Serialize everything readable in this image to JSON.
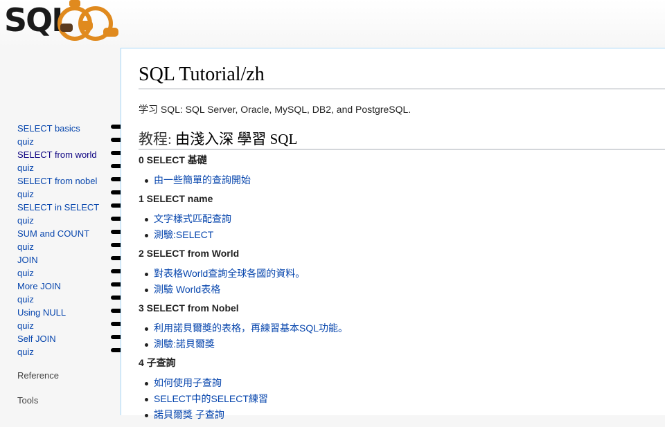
{
  "logo": {
    "text": "SQL",
    "alt": "sqlzoo-logo"
  },
  "sidebar": {
    "nav": [
      {
        "label": "SELECT basics",
        "visited": false
      },
      {
        "label": "quiz",
        "visited": false
      },
      {
        "label": "SELECT from world",
        "visited": true
      },
      {
        "label": "quiz",
        "visited": false
      },
      {
        "label": "SELECT from nobel",
        "visited": false
      },
      {
        "label": "quiz",
        "visited": false
      },
      {
        "label": "SELECT in SELECT",
        "visited": false
      },
      {
        "label": "quiz",
        "visited": false
      },
      {
        "label": "SUM and COUNT",
        "visited": false
      },
      {
        "label": "quiz",
        "visited": false
      },
      {
        "label": "JOIN",
        "visited": false
      },
      {
        "label": "quiz",
        "visited": false
      },
      {
        "label": "More JOIN",
        "visited": false
      },
      {
        "label": "quiz",
        "visited": false
      },
      {
        "label": "Using NULL",
        "visited": false
      },
      {
        "label": "quiz",
        "visited": false
      },
      {
        "label": "Self JOIN",
        "visited": false
      },
      {
        "label": "quiz",
        "visited": false
      }
    ],
    "reference_label": "Reference",
    "tools_label": "Tools"
  },
  "content": {
    "title": "SQL Tutorial/zh",
    "intro": "学习 SQL: SQL Server, Oracle, MySQL, DB2, and PostgreSQL.",
    "tutorial_heading_prefix": "教程:",
    "tutorial_heading_rest": " 由淺入深 學習 SQL",
    "lessons": [
      {
        "title": "0 SELECT 基礎",
        "links": [
          "由一些簡單的查詢開始"
        ]
      },
      {
        "title": "1 SELECT name",
        "links": [
          "文字樣式匹配查詢",
          "測驗:SELECT"
        ]
      },
      {
        "title": "2 SELECT from World",
        "links": [
          "對表格World查詢全球各國的資料。",
          "測驗 World表格"
        ]
      },
      {
        "title": "3 SELECT from Nobel",
        "links": [
          "利用諾貝爾獎的表格，再練習基本SQL功能。",
          "測驗:諾貝爾獎"
        ]
      },
      {
        "title": "4 子查詢",
        "links": [
          "如何使用子查詢",
          "SELECT中的SELECT練習",
          "諾貝爾獎 子查詢"
        ]
      }
    ]
  },
  "colors": {
    "link": "#0645ad",
    "visited": "#0b0080",
    "content_border": "#a7d7f9",
    "logo_accent": "#e08a1e"
  }
}
